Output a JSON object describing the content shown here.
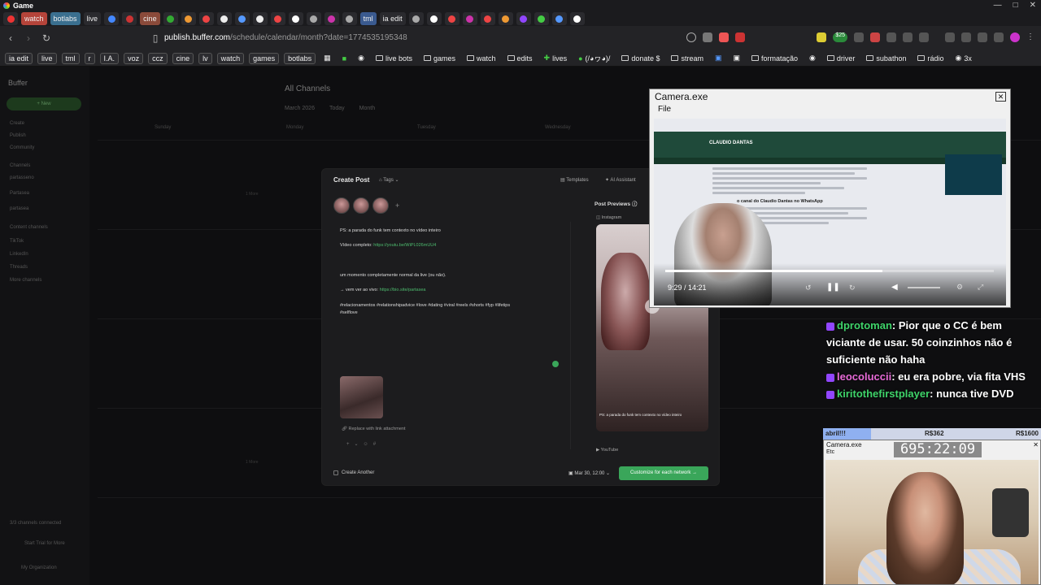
{
  "window": {
    "title": "Game"
  },
  "tabs": [
    {
      "label": "watch",
      "color": "#b5443a"
    },
    {
      "label": "botlabs",
      "color": "#3a6f8f"
    },
    {
      "label": "live",
      "color": "#444"
    },
    {
      "label": "cine",
      "color": "#8a4a3a"
    },
    {
      "label": "tml",
      "color": "#3a5a8f"
    },
    {
      "label": "ia edit",
      "color": "#333"
    }
  ],
  "address": {
    "host": "publish.buffer.com",
    "path": "/schedule/calendar/month?date=1774535195348",
    "badge": "$25"
  },
  "bookmarks": {
    "chips": [
      "ia edit",
      "live",
      "tml",
      "r",
      "I.A.",
      "voz",
      "ccz",
      "cine",
      "lv",
      "watch",
      "games",
      "botlabs"
    ],
    "folders": [
      "live bots",
      "games",
      "watch",
      "edits",
      "lives",
      "(/◕ヮ◕)/",
      "donate $",
      "stream",
      "formatação",
      "driver",
      "subathon",
      "rádio",
      "3x"
    ]
  },
  "buffer": {
    "brand": "Buffer",
    "new_button": "+ New",
    "sidebar_items": [
      "Create",
      "Publish",
      "Community",
      "Channels",
      "partasseno",
      "Partasea",
      "partasea",
      "Content channels",
      "TikTok",
      "LinkedIn",
      "Threads",
      "More channels",
      "3/3 channels connected",
      "Start Trial for More",
      "My Organization"
    ],
    "calendar_title": "All Channels",
    "month": "March 2026",
    "today": "Today",
    "view": "Month",
    "days": [
      "Sunday",
      "Monday",
      "Tuesday",
      "Wednesday"
    ],
    "more": "1 More"
  },
  "modal": {
    "title": "Create Post",
    "tags": "Tags",
    "templates": "Templates",
    "ai": "AI Assistant",
    "add": "+",
    "lines": [
      {
        "text": "PS: a parada do funk tem contexto no vídeo inteiro",
        "link": ""
      },
      {
        "text": "Vídeo completo: ",
        "link": "https://youtu.be/WiPL026mUU4"
      },
      {
        "text": "um momento completamente normal da live (ou não).",
        "link": ""
      },
      {
        "text": "→ vem ver ao vivo: ",
        "link": "https://bio.site/partasea"
      },
      {
        "text": "#relacionamentos #relationshipadvice #love #dating #viral #reels #shorts #fyp #lifetips",
        "link": ""
      },
      {
        "text": "#selflove",
        "link": ""
      }
    ],
    "replace": "Replace with link attachment",
    "previews_title": "Post Previews",
    "instagram": "Instagram",
    "preview_caption": "PS: a parada do funk tem contexto no vídeo inteiro",
    "youtube": "YouTube",
    "create_another": "Create Another",
    "date": "Mar 30, 12:00",
    "customize": "Customize for each network →"
  },
  "camera1": {
    "title": "Camera.exe",
    "menu": "File",
    "site_logo": "CLAUDIO DANTAS",
    "article_heading": "o canal do Claudio Dantas no WhatsApp",
    "time": "9:29 / 14:21",
    "progress": 0.66
  },
  "chat": [
    {
      "user": "dprotoman",
      "color": "#3fd46a",
      "text": ": Pior que o CC é bem viciante de usar. 50 coinzinhos não é suficiente não haha"
    },
    {
      "user": "leocoluccii",
      "color": "#e86bd8",
      "text": ": eu era pobre, via fita VHS"
    },
    {
      "user": "kiritothefirstplayer",
      "color": "#3fd46a",
      "text": ": nunca tive DVD"
    }
  ],
  "timer": {
    "label": "abril!!!",
    "mid": "R$362",
    "goal": "R$1600",
    "progress": 0.22
  },
  "camera2": {
    "title": "Camera.exe",
    "menu": "Etc",
    "countdown": "695:22:09"
  }
}
